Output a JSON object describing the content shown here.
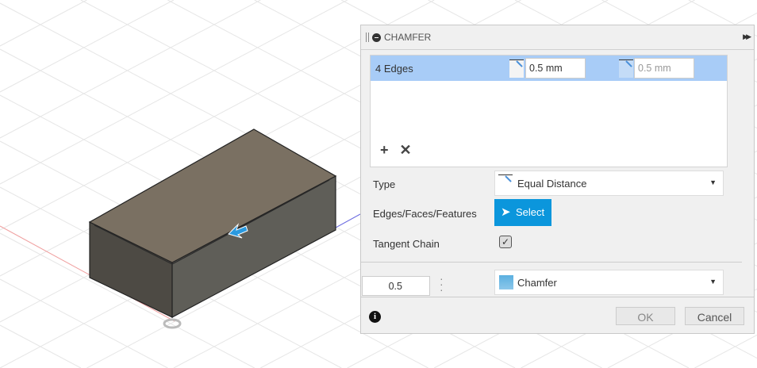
{
  "dialog": {
    "title": "CHAMFER",
    "expand_icon": "double-arrow-right-icon",
    "selection": {
      "label": "4 Edges",
      "distance1": "0.5 mm",
      "distance2": "0.5 mm"
    },
    "type_label": "Type",
    "type_value": "Equal Distance",
    "edges_label": "Edges/Faces/Features",
    "select_button": "Select",
    "tangent_label": "Tangent Chain",
    "tangent_checked": true,
    "value_input": "0.5",
    "corner_type": "Chamfer",
    "ok": "OK",
    "cancel": "Cancel"
  },
  "colors": {
    "accent": "#0b96dc",
    "selection": "#a8ccf7"
  }
}
